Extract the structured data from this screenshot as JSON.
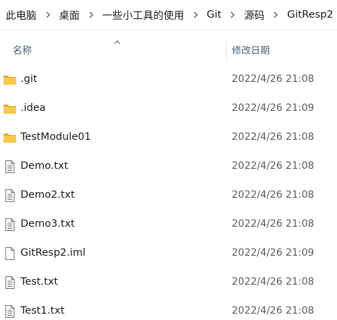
{
  "breadcrumb": {
    "items": [
      "此电脑",
      "桌面",
      "一些小工具的使用",
      "Git",
      "源码",
      "GitResp2"
    ]
  },
  "columns": {
    "name": "名称",
    "modified": "修改日期"
  },
  "files": [
    {
      "name": ".git",
      "modified": "2022/4/26 21:08",
      "icon": "folder-icon"
    },
    {
      "name": ".idea",
      "modified": "2022/4/26 21:09",
      "icon": "folder-icon"
    },
    {
      "name": "TestModule01",
      "modified": "2022/4/26 21:08",
      "icon": "folder-icon"
    },
    {
      "name": "Demo.txt",
      "modified": "2022/4/26 21:08",
      "icon": "text-file-icon"
    },
    {
      "name": "Demo2.txt",
      "modified": "2022/4/26 21:08",
      "icon": "text-file-icon"
    },
    {
      "name": "Demo3.txt",
      "modified": "2022/4/26 21:08",
      "icon": "text-file-icon"
    },
    {
      "name": "GitResp2.iml",
      "modified": "2022/4/26 21:09",
      "icon": "file-icon"
    },
    {
      "name": "Test.txt",
      "modified": "2022/4/26 21:08",
      "icon": "text-file-icon"
    },
    {
      "name": "Test1.txt",
      "modified": "2022/4/26 21:08",
      "icon": "text-file-icon"
    }
  ],
  "colors": {
    "folder": "#f7c94c",
    "folder_dark": "#e0a92c",
    "header_text": "#4c607a"
  }
}
